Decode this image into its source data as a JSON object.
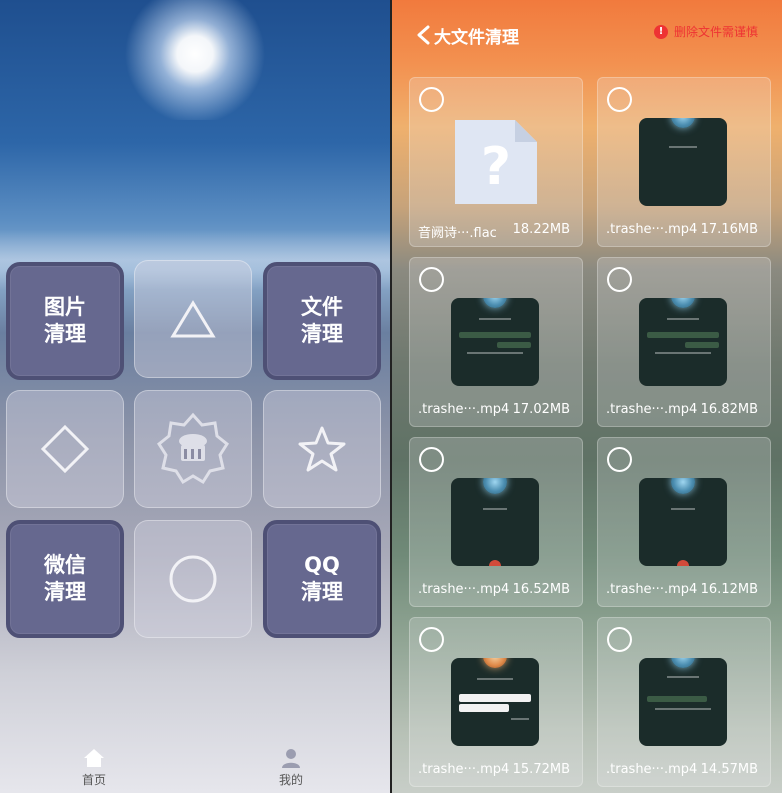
{
  "left_screen": {
    "tiles": [
      {
        "label": "图片\n清理",
        "kind": "text"
      },
      {
        "label": "",
        "kind": "triangle"
      },
      {
        "label": "文件\n清理",
        "kind": "text"
      },
      {
        "label": "",
        "kind": "diamond"
      },
      {
        "label": "",
        "kind": "clean-badge"
      },
      {
        "label": "",
        "kind": "star"
      },
      {
        "label": "微信\n清理",
        "kind": "text"
      },
      {
        "label": "",
        "kind": "circle"
      },
      {
        "label": "QQ\n清理",
        "kind": "text"
      }
    ],
    "nav": {
      "home_label": "首页",
      "mine_label": "我的"
    }
  },
  "right_screen": {
    "header": {
      "title": "大文件清理",
      "warning": "删除文件需谨慎"
    },
    "files": [
      {
        "name": "音阙诗···.flac",
        "size": "18.22MB",
        "thumb": "unknown"
      },
      {
        "name": ".trashe···.mp4",
        "size": "17.16MB",
        "thumb": "video-a"
      },
      {
        "name": ".trashe···.mp4",
        "size": "17.02MB",
        "thumb": "video-b"
      },
      {
        "name": ".trashe···.mp4",
        "size": "16.82MB",
        "thumb": "video-b"
      },
      {
        "name": ".trashe···.mp4",
        "size": "16.52MB",
        "thumb": "video-c"
      },
      {
        "name": ".trashe···.mp4",
        "size": "16.12MB",
        "thumb": "video-c"
      },
      {
        "name": ".trashe···.mp4",
        "size": "15.72MB",
        "thumb": "video-d"
      },
      {
        "name": ".trashe···.mp4",
        "size": "14.57MB",
        "thumb": "video-e"
      }
    ]
  },
  "colors": {
    "tile_solid": "#66688f",
    "warning_red": "#ee3333",
    "icon_white": "#ffffff"
  },
  "icons": [
    "back-icon",
    "warning-icon",
    "home-icon",
    "user-icon",
    "triangle-icon",
    "diamond-icon",
    "cleaner-badge-icon",
    "star-icon",
    "circle-icon",
    "unknown-file-icon"
  ]
}
